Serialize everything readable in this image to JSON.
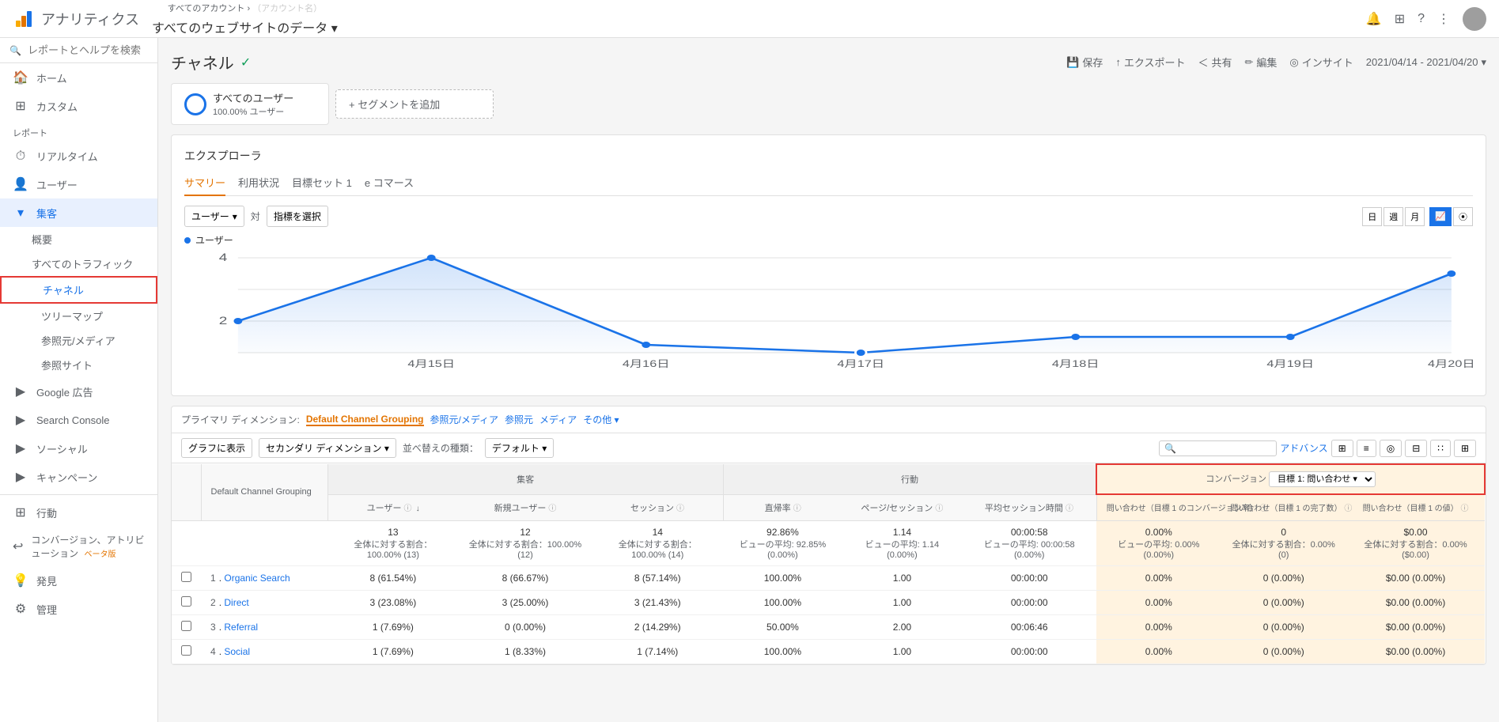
{
  "header": {
    "logo_text": "アナリティクス",
    "breadcrumb_top": "すべてのアカウント ›",
    "breadcrumb_account": "（アカウント名）",
    "site_selector": "すべてのウェブサイトのデータ ▾",
    "actions": {
      "bell": "🔔",
      "grid": "⊞",
      "help": "?",
      "more": "⋮"
    }
  },
  "sidebar": {
    "search_placeholder": "レポートとヘルプを検索",
    "items": [
      {
        "id": "home",
        "icon": "🏠",
        "label": "ホーム"
      },
      {
        "id": "custom",
        "icon": "⊞",
        "label": "カスタム"
      }
    ],
    "report_section": "レポート",
    "sub_items": [
      {
        "id": "realtime",
        "icon": "⏱",
        "label": "リアルタイム"
      },
      {
        "id": "user",
        "icon": "👤",
        "label": "ユーザー"
      },
      {
        "id": "audience",
        "icon": "👥",
        "label": "集客",
        "expanded": true
      },
      {
        "id": "overview",
        "label": "概要",
        "indent": 1
      },
      {
        "id": "all-traffic",
        "label": "すべてのトラフィック",
        "indent": 1,
        "expanded": true
      },
      {
        "id": "channel",
        "label": "チャネル",
        "indent": 2,
        "active": true,
        "highlighted": true
      },
      {
        "id": "treemap",
        "label": "ツリーマップ",
        "indent": 2
      },
      {
        "id": "source-medium",
        "label": "参照元/メディア",
        "indent": 2
      },
      {
        "id": "referral",
        "label": "参照サイト",
        "indent": 2
      },
      {
        "id": "google-ads",
        "icon": "▶",
        "label": "Google 広告",
        "indent": 1
      },
      {
        "id": "search-console",
        "icon": "▶",
        "label": "Search Console",
        "indent": 1
      },
      {
        "id": "social",
        "icon": "▶",
        "label": "ソーシャル",
        "indent": 1
      },
      {
        "id": "campaign",
        "icon": "▶",
        "label": "キャンペーン",
        "indent": 1
      },
      {
        "id": "behavior",
        "icon": "⊞",
        "label": "行動"
      },
      {
        "id": "conversion-attr",
        "icon": "↩",
        "label": "コンバージョン、アトリビューション",
        "beta": true
      },
      {
        "id": "discover",
        "icon": "💡",
        "label": "発見"
      },
      {
        "id": "admin",
        "icon": "⚙",
        "label": "管理"
      }
    ]
  },
  "page": {
    "title": "チャネル",
    "title_check": "✓",
    "save_label": "保存",
    "export_label": "エクスポート",
    "share_label": "共有",
    "edit_label": "編集",
    "insight_label": "インサイト",
    "date_range": "2021/04/14 - 2021/04/20"
  },
  "segment": {
    "chip_title": "すべてのユーザー",
    "chip_sub": "100.00% ユーザー",
    "add_label": "+ セグメントを追加"
  },
  "explorer": {
    "title": "エクスプローラ",
    "tabs": [
      "サマリー",
      "利用状況",
      "目標セット 1",
      "e コマース"
    ],
    "active_tab": "サマリー",
    "metric_selector": "ユーザー",
    "vs_text": "対",
    "metric_placeholder": "指標を選択",
    "view_btns": [
      "日",
      "週",
      "月"
    ],
    "chart_btns": [
      "line",
      "scatter"
    ],
    "legend_label": "ユーザー",
    "y_axis_max": "4",
    "y_axis_mid": "2",
    "x_labels": [
      "4月15日",
      "4月16日",
      "4月17日",
      "4月18日",
      "4月19日",
      "4月20日"
    ]
  },
  "table": {
    "primary_dim_label": "プライマリ ディメンション:",
    "primary_dim_current": "Default Channel Grouping",
    "dim_links": [
      "参照元/メディア",
      "参照元",
      "メディア",
      "その他 ▾"
    ],
    "graph_button": "グラフに表示",
    "secondary_dim_label": "セカンダリ ディメンション ▾",
    "sort_label": "並べ替えの種類：",
    "sort_value": "デフォルト ▾",
    "search_placeholder": "",
    "advance_label": "アドバンス",
    "view_icons": [
      "grid",
      "bar",
      "pie",
      "table",
      "scatter",
      "pivot"
    ],
    "col_groups": {
      "acquisition": "集客",
      "behavior": "行動",
      "conversion": "コンバージョン"
    },
    "goal_select": "目標 1: 問い合わせ ▾",
    "columns": {
      "dim": "Default Channel Grouping",
      "users": "ユーザー",
      "new_users": "新規ユーザー",
      "sessions": "セッション",
      "bounce_rate": "直帰率",
      "pages_session": "ページ/セッション",
      "avg_session": "平均セッション時間",
      "conv_rate": "問い合わせ（目標 1 のコンバージョン率）",
      "conv_complete": "問い合わせ（目標 1 の完了数）",
      "conv_value": "問い合わせ（目標 1 の値）"
    },
    "totals": {
      "users": "13",
      "users_pct": "全体に対する割合：100.00% (13)",
      "new_users": "12",
      "new_users_pct": "全体に対する割合：100.00% (12)",
      "sessions": "14",
      "sessions_pct": "全体に対する割合：100.00% (14)",
      "bounce_rate": "92.86%",
      "bounce_pct": "ビューの平均: 92.85% (0.00%)",
      "pages_session": "1.14",
      "pages_avg": "ビューの平均: 1.14 (0.00%)",
      "avg_session": "00:00:58",
      "avg_session_avg": "ビューの平均: 00:00:58 (0.00%)",
      "conv_rate": "0.00%",
      "conv_rate_avg": "ビューの平均: 0.00% (0.00%)",
      "conv_complete": "0",
      "conv_complete_pct": "全体に対する割合：0.00% (0)",
      "conv_value": "$0.00",
      "conv_value_pct": "全体に対する割合：0.00% ($0.00)"
    },
    "rows": [
      {
        "rank": "1",
        "name": "Organic Search",
        "users": "8 (61.54%)",
        "new_users": "8 (66.67%)",
        "sessions": "8 (57.14%)",
        "bounce_rate": "100.00%",
        "pages_session": "1.00",
        "avg_session": "00:00:00",
        "conv_rate": "0.00%",
        "conv_complete": "0 (0.00%)",
        "conv_value": "$0.00 (0.00%)"
      },
      {
        "rank": "2",
        "name": "Direct",
        "users": "3 (23.08%)",
        "new_users": "3 (25.00%)",
        "sessions": "3 (21.43%)",
        "bounce_rate": "100.00%",
        "pages_session": "1.00",
        "avg_session": "00:00:00",
        "conv_rate": "0.00%",
        "conv_complete": "0 (0.00%)",
        "conv_value": "$0.00 (0.00%)"
      },
      {
        "rank": "3",
        "name": "Referral",
        "users": "1 (7.69%)",
        "new_users": "0 (0.00%)",
        "sessions": "2 (14.29%)",
        "bounce_rate": "50.00%",
        "pages_session": "2.00",
        "avg_session": "00:06:46",
        "conv_rate": "0.00%",
        "conv_complete": "0 (0.00%)",
        "conv_value": "$0.00 (0.00%)"
      },
      {
        "rank": "4",
        "name": "Social",
        "users": "1 (7.69%)",
        "new_users": "1 (8.33%)",
        "sessions": "1 (7.14%)",
        "bounce_rate": "100.00%",
        "pages_session": "1.00",
        "avg_session": "00:00:00",
        "conv_rate": "0.00%",
        "conv_complete": "0 (0.00%)",
        "conv_value": "$0.00 (0.00%)"
      }
    ]
  },
  "colors": {
    "accent_blue": "#1a73e8",
    "accent_orange": "#e37400",
    "accent_green": "#0f9d58",
    "accent_red": "#e53935",
    "chart_line": "#1a73e8",
    "conversion_bg": "#fff3e0"
  }
}
